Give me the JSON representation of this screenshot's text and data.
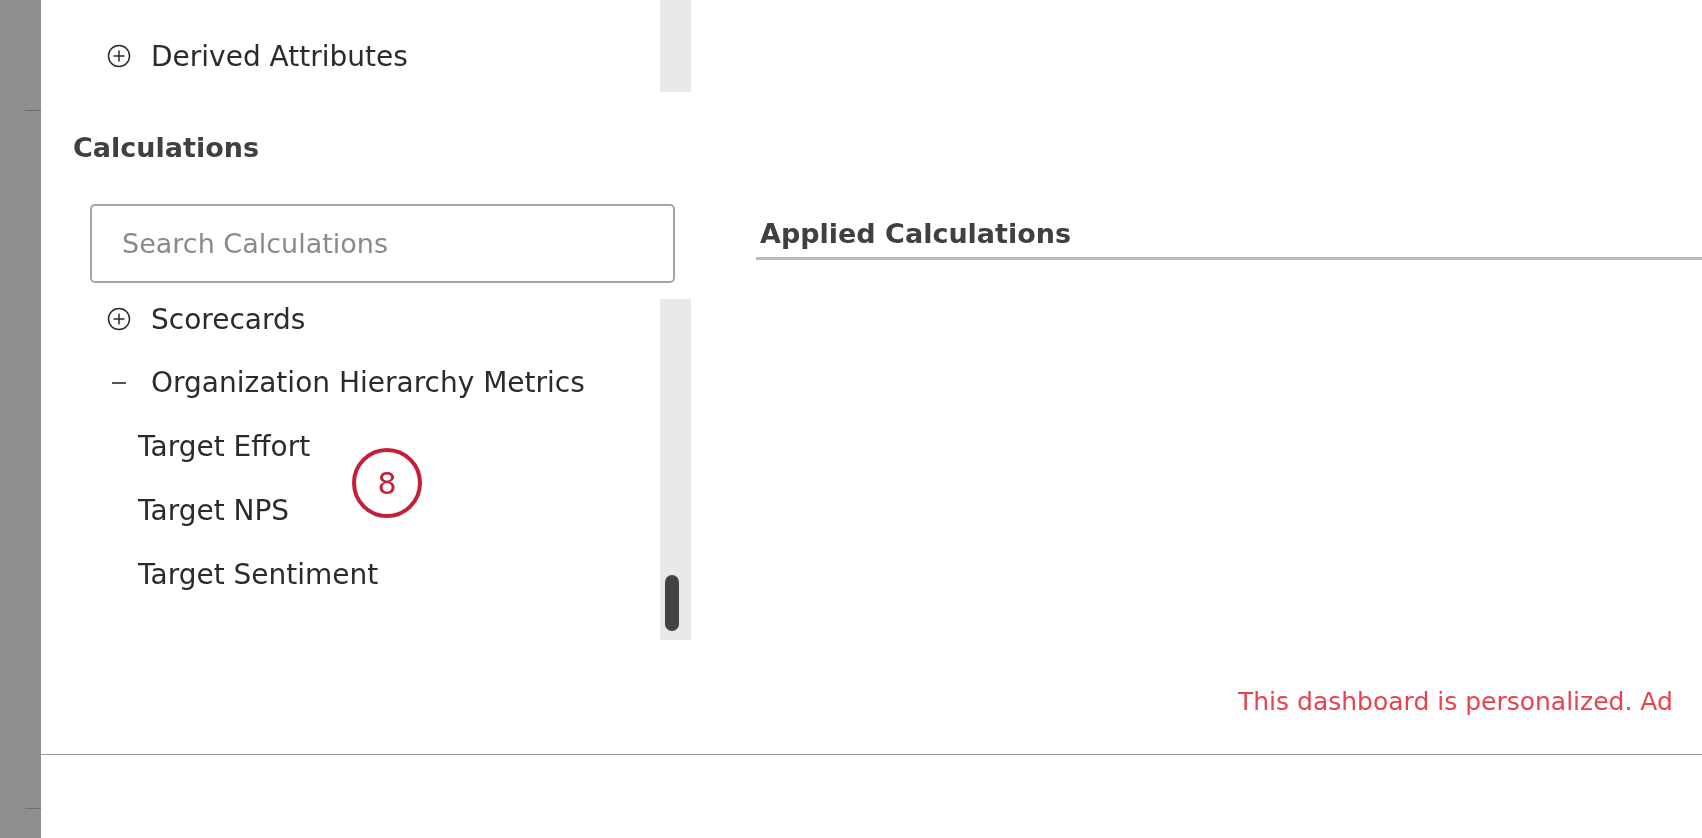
{
  "attributes_tree": {
    "items": [
      {
        "label": "Derived Attributes",
        "expanded": false
      }
    ]
  },
  "calculations": {
    "title": "Calculations",
    "search": {
      "placeholder": "Search Calculations"
    },
    "items": [
      {
        "label": "Scorecards",
        "expanded": false
      },
      {
        "label": "Organization Hierarchy Metrics",
        "expanded": true,
        "children": [
          {
            "label": "Target Effort"
          },
          {
            "label": "Target NPS"
          },
          {
            "label": "Target Sentiment"
          }
        ]
      }
    ]
  },
  "applied": {
    "title": "Applied Calculations"
  },
  "callout": {
    "number": "8"
  },
  "message": "This dashboard is personalized. Ad"
}
